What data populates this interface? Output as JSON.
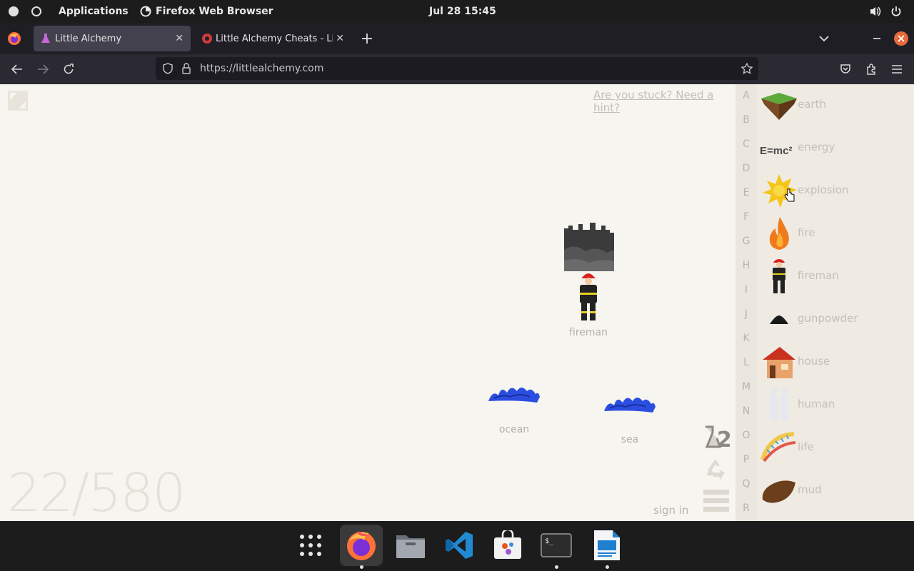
{
  "topbar": {
    "activities": "Applications",
    "app_name": "Firefox Web Browser",
    "clock": "Jul 28  15:45"
  },
  "browser": {
    "tabs": [
      {
        "label": "Little Alchemy",
        "active": true
      },
      {
        "label": "Little Alchemy Cheats - List",
        "active": false
      }
    ],
    "new_tab": "+",
    "url": "https://littlealchemy.com"
  },
  "game": {
    "hint_link": "Are you stuck? Need a hint?",
    "counter": "22/580",
    "sign_in": "sign in",
    "workspace_items": [
      {
        "label": "",
        "icon": "ruins-icon"
      },
      {
        "label": "fireman",
        "icon": "fireman-icon"
      },
      {
        "label": "ocean",
        "icon": "wave-icon"
      },
      {
        "label": "sea",
        "icon": "wave-icon"
      }
    ],
    "letters": [
      "A",
      "B",
      "C",
      "D",
      "E",
      "F",
      "G",
      "H",
      "I",
      "J",
      "K",
      "L",
      "M",
      "N",
      "O",
      "P",
      "Q",
      "R"
    ],
    "elements": [
      {
        "name": "earth",
        "icon": "earth-icon"
      },
      {
        "name": "energy",
        "icon": "energy-icon",
        "icon_text": "E=mc²"
      },
      {
        "name": "explosion",
        "icon": "explosion-icon"
      },
      {
        "name": "fire",
        "icon": "fire-icon"
      },
      {
        "name": "fireman",
        "icon": "fireman-icon"
      },
      {
        "name": "gunpowder",
        "icon": "gunpowder-icon"
      },
      {
        "name": "house",
        "icon": "house-icon"
      },
      {
        "name": "human",
        "icon": "human-icon"
      },
      {
        "name": "life",
        "icon": "life-icon"
      },
      {
        "name": "mud",
        "icon": "mud-icon"
      }
    ],
    "tools": [
      {
        "icon": "flask-icon",
        "text": "2"
      },
      {
        "icon": "recycle-icon"
      },
      {
        "icon": "menu-icon"
      }
    ]
  },
  "dock": {
    "apps": [
      {
        "name": "app-grid-icon",
        "running": false
      },
      {
        "name": "firefox-icon",
        "running": true
      },
      {
        "name": "files-icon",
        "running": false
      },
      {
        "name": "vscode-icon",
        "running": false
      },
      {
        "name": "software-store-icon",
        "running": false
      },
      {
        "name": "terminal-icon",
        "running": true
      },
      {
        "name": "libreoffice-impress-icon",
        "running": true
      }
    ]
  },
  "colors": {
    "firefox_orange": "#ff7139",
    "close_button": "#e66a3c",
    "wave_blue": "#2c4ee0"
  }
}
